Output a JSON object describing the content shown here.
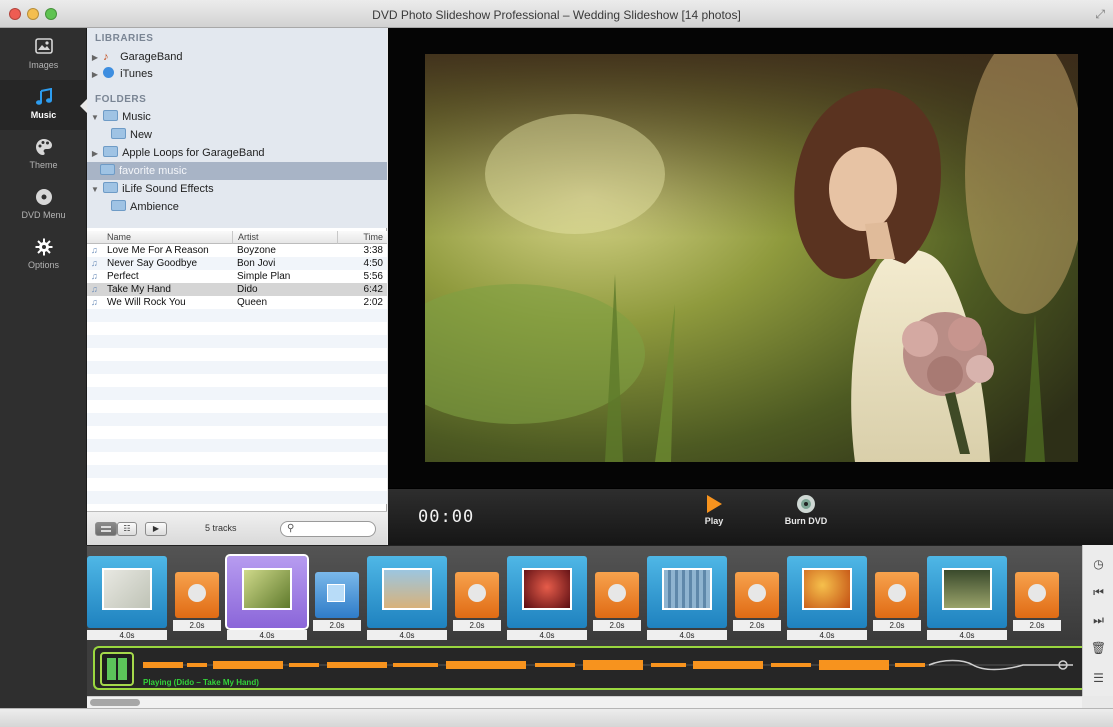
{
  "window": {
    "title": "DVD Photo Slideshow Professional – Wedding Slideshow [14 photos]"
  },
  "rail": {
    "items": [
      {
        "label": "Images",
        "icon": "image-icon"
      },
      {
        "label": "Music",
        "icon": "music-note-icon",
        "active": true
      },
      {
        "label": "Theme",
        "icon": "palette-icon"
      },
      {
        "label": "DVD Menu",
        "icon": "disc-icon"
      },
      {
        "label": "Options",
        "icon": "gear-icon"
      }
    ]
  },
  "sources": {
    "libraries_heading": "LIBRARIES",
    "folders_heading": "FOLDERS",
    "libraries": [
      "GarageBand",
      "iTunes"
    ],
    "folders": [
      "Music",
      "New",
      "Apple Loops for GarageBand",
      "favorite music",
      "iLife Sound Effects",
      "Ambience"
    ],
    "selected": "favorite music"
  },
  "tracks": {
    "columns": {
      "name": "Name",
      "artist": "Artist",
      "time": "Time"
    },
    "rows": [
      {
        "name": "Love Me For A Reason",
        "artist": "Boyzone",
        "time": "3:38"
      },
      {
        "name": "Never Say Goodbye",
        "artist": "Bon Jovi",
        "time": "4:50"
      },
      {
        "name": "Perfect",
        "artist": "Simple Plan",
        "time": "5:56"
      },
      {
        "name": "Take My Hand",
        "artist": "Dido",
        "time": "6:42",
        "selected": true
      },
      {
        "name": "We Will Rock You",
        "artist": "Queen",
        "time": "2:02"
      }
    ],
    "count_label": "5 tracks"
  },
  "transport": {
    "timecode": "00:00",
    "play_label": "Play",
    "burn_label": "Burn DVD"
  },
  "storyboard": {
    "slides": [
      {
        "duration": "4.0s",
        "transition": "2.0s"
      },
      {
        "duration": "4.0s",
        "transition": "2.0s",
        "selected": true
      },
      {
        "duration": "4.0s",
        "transition": "2.0s"
      },
      {
        "duration": "4.0s",
        "transition": "2.0s"
      },
      {
        "duration": "4.0s",
        "transition": "2.0s"
      },
      {
        "duration": "4.0s",
        "transition": "2.0s"
      },
      {
        "duration": "4.0s",
        "transition": "2.0s"
      }
    ]
  },
  "audio": {
    "playing_label": "Playing (Dido – Take My Hand)"
  },
  "colors": {
    "accent_orange": "#f7931e",
    "audio_green": "#9ad73f",
    "selection_purple": "#8b66d9",
    "tile_blue": "#2a93d1"
  }
}
